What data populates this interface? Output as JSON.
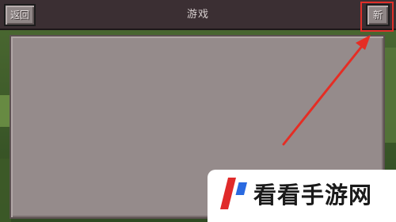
{
  "topbar": {
    "back_label": "返回",
    "title": "游戏",
    "new_label": "新"
  },
  "world_list": {
    "items": []
  },
  "watermark": {
    "text": "看看手游网"
  },
  "colors": {
    "highlight": "#e0302a",
    "panel": "#958b8b",
    "topbar": "#3b2f33"
  }
}
